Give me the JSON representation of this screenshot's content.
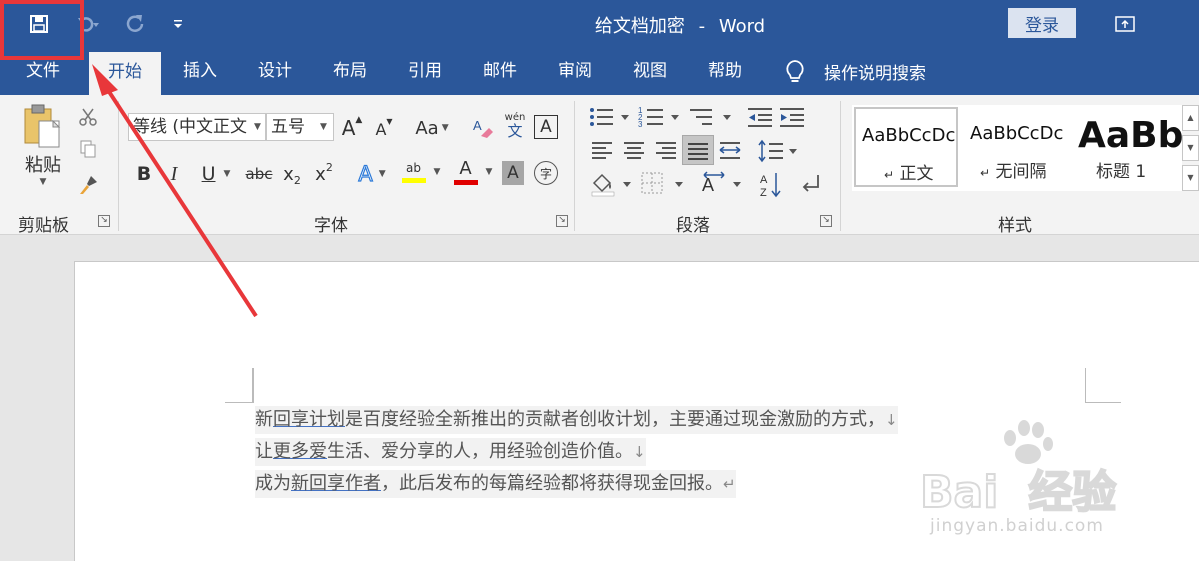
{
  "titlebar": {
    "title": "给文档加密",
    "separator": "-",
    "app_name": "Word",
    "login_label": "登录",
    "qat": [
      "save-icon",
      "undo-icon",
      "redo-icon",
      "customize-icon"
    ]
  },
  "tabs": [
    "文件",
    "开始",
    "插入",
    "设计",
    "布局",
    "引用",
    "邮件",
    "审阅",
    "视图",
    "帮助"
  ],
  "active_tab": "开始",
  "tell_me": "操作说明搜索",
  "ribbon": {
    "clipboard": {
      "paste_label": "粘贴",
      "group_label": "剪贴板"
    },
    "font": {
      "font_name": "等线 (中文正文",
      "font_size": "五号",
      "grow": "A",
      "shrink": "A",
      "change_case": "Aa",
      "phonetic_top": "wén",
      "phonetic_bottom": "文",
      "border_char": "A",
      "bold": "B",
      "italic": "I",
      "underline": "U",
      "strike": "abc",
      "subscript": "x",
      "subscript_small": "2",
      "superscript": "x",
      "superscript_small": "2",
      "effects": "A",
      "highlight": "ab",
      "font_color": "A",
      "shading_char": "A",
      "enclose_char": "字",
      "group_label": "字体"
    },
    "paragraph": {
      "group_label": "段落"
    },
    "styles": {
      "items": [
        {
          "preview": "AaBbCcDc",
          "name": "正文"
        },
        {
          "preview": "AaBbCcDc",
          "name": "无间隔"
        },
        {
          "preview": "AaBb",
          "name": "标题 1"
        }
      ],
      "group_label": "样式"
    }
  },
  "document": {
    "lines": [
      [
        {
          "t": "新",
          "u": false
        },
        {
          "t": "回享计划",
          "u": true
        },
        {
          "t": "是百度经验全新推出的贡献者创收计划，主要通过现金激励的方式，",
          "u": false
        },
        {
          "t": "↓",
          "u": false,
          "m": true
        }
      ],
      [
        {
          "t": "让",
          "u": false
        },
        {
          "t": "更多爱",
          "u": true
        },
        {
          "t": "生活、爱分享的人，用经验创造价值。",
          "u": false
        },
        {
          "t": "↓",
          "u": false,
          "m": true
        }
      ],
      [
        {
          "t": "成为",
          "u": false
        },
        {
          "t": "新回享作者",
          "u": true
        },
        {
          "t": "，此后发布的每篇经验都将获得现金回报。",
          "u": false
        },
        {
          "t": "↵",
          "u": false,
          "m": true
        }
      ]
    ]
  },
  "watermark": {
    "brand": "Bai",
    "brand_cn": "经验",
    "url": "jingyan.baidu.com"
  },
  "colors": {
    "accent": "#2b579a",
    "annotation": "#e8373a"
  }
}
